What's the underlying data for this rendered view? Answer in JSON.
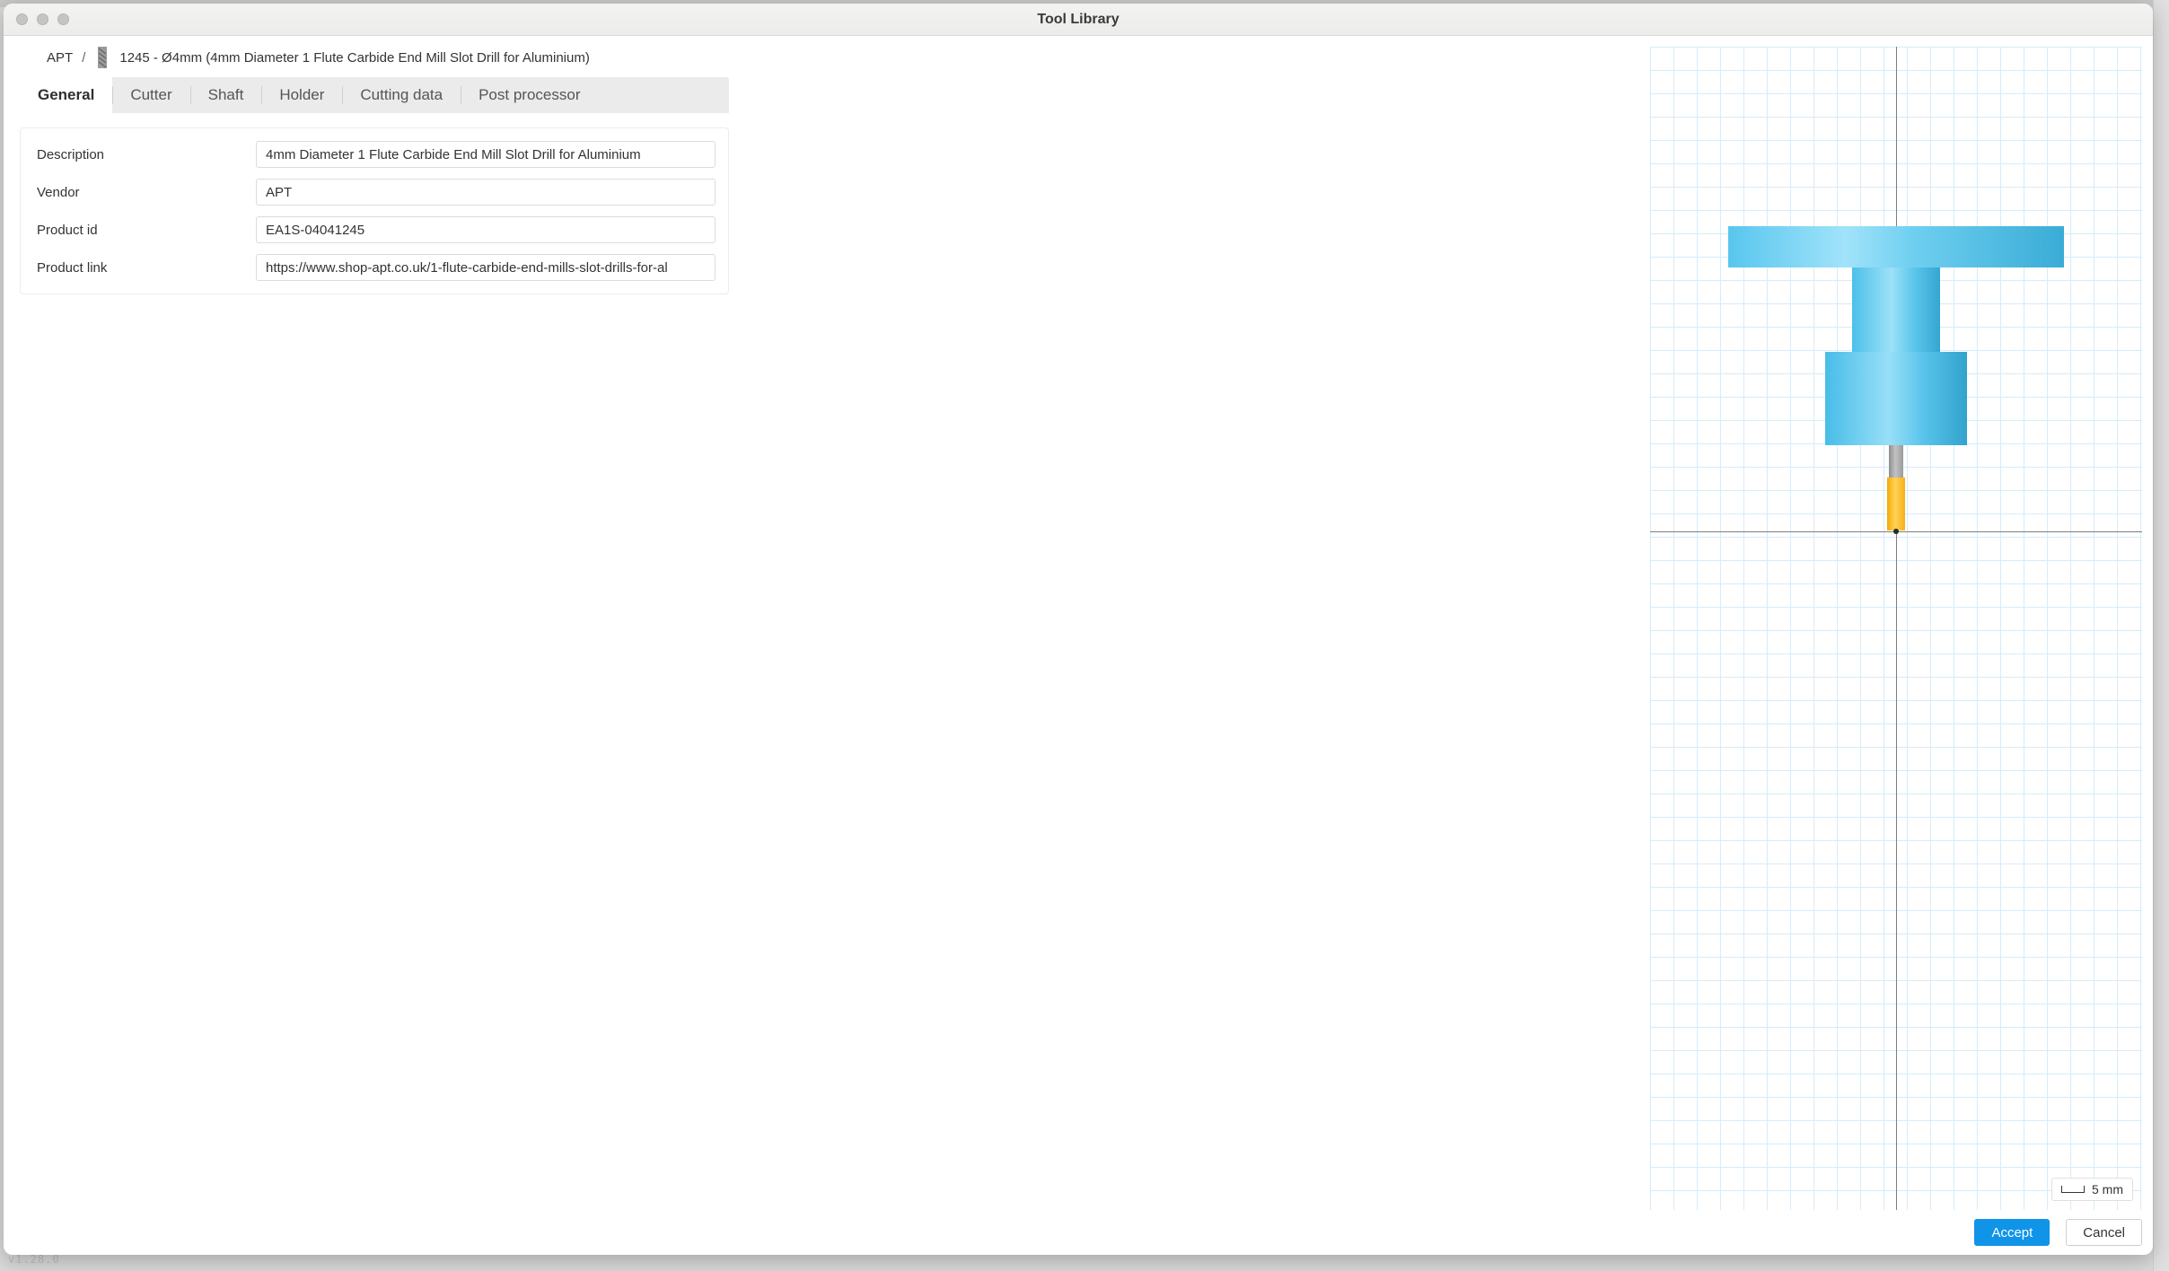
{
  "window": {
    "title": "Tool Library"
  },
  "breadcrumb": {
    "vendor": "APT",
    "tool_label": "1245 - Ø4mm (4mm Diameter 1 Flute Carbide End Mill Slot Drill for Aluminium)"
  },
  "tabs": {
    "general": "General",
    "cutter": "Cutter",
    "shaft": "Shaft",
    "holder": "Holder",
    "cutting_data": "Cutting data",
    "post_processor": "Post processor"
  },
  "form": {
    "labels": {
      "description": "Description",
      "vendor": "Vendor",
      "product_id": "Product id",
      "product_link": "Product link"
    },
    "values": {
      "description": "4mm Diameter 1 Flute Carbide End Mill Slot Drill for Aluminium",
      "vendor": "APT",
      "product_id": "EA1S-04041245",
      "product_link": "https://www.shop-apt.co.uk/1-flute-carbide-end-mills-slot-drills-for-al"
    }
  },
  "preview": {
    "scale_label": "5 mm"
  },
  "buttons": {
    "accept": "Accept",
    "cancel": "Cancel"
  },
  "background": {
    "version": "v1.28.0"
  }
}
